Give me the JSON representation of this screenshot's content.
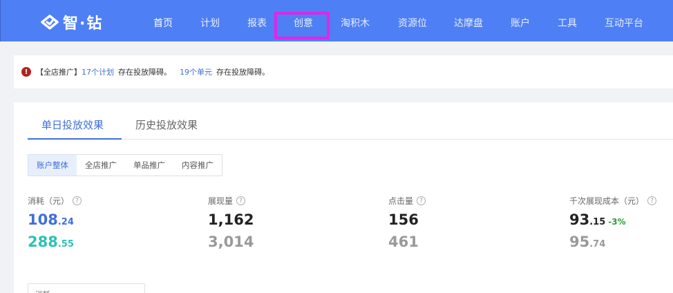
{
  "header": {
    "logo_text": "智·钻",
    "nav": [
      {
        "label": "首页",
        "active": true
      },
      {
        "label": "计划",
        "active": false
      },
      {
        "label": "报表",
        "active": false
      },
      {
        "label": "创意",
        "active": false
      },
      {
        "label": "淘积木",
        "active": false
      },
      {
        "label": "资源位",
        "active": false
      },
      {
        "label": "达摩盘",
        "active": false
      },
      {
        "label": "账户",
        "active": false
      },
      {
        "label": "工具",
        "active": false
      },
      {
        "label": "互动平台",
        "active": false
      }
    ],
    "colors": {
      "bar": "#4f7ff5",
      "highlight": "#e026e6"
    }
  },
  "alert": {
    "prefix": "【全店推广】",
    "plan_count_link": "17个计划",
    "plan_text": "存在投放障碍。",
    "unit_count_link": "19个单元",
    "unit_text": "存在投放障碍。"
  },
  "tabs": [
    "单日投放效果",
    "历史投放效果"
  ],
  "filters": [
    "账户整体",
    "全店推广",
    "单品推广",
    "内容推广"
  ],
  "metrics": [
    {
      "label": "消耗（元）",
      "current_main": "108",
      "current_dec": ".24",
      "previous_main": "288",
      "previous_dec": ".55",
      "change": ""
    },
    {
      "label": "展现量",
      "current_main": "1,162",
      "current_dec": "",
      "previous_main": "3,014",
      "previous_dec": "",
      "change": ""
    },
    {
      "label": "点击量",
      "current_main": "156",
      "current_dec": "",
      "previous_main": "461",
      "previous_dec": "",
      "change": ""
    },
    {
      "label": "千次展现成本（元）",
      "current_main": "93",
      "current_dec": ".15",
      "previous_main": "95",
      "previous_dec": ".74",
      "change": "-3%"
    }
  ],
  "select": {
    "value": "消耗"
  }
}
